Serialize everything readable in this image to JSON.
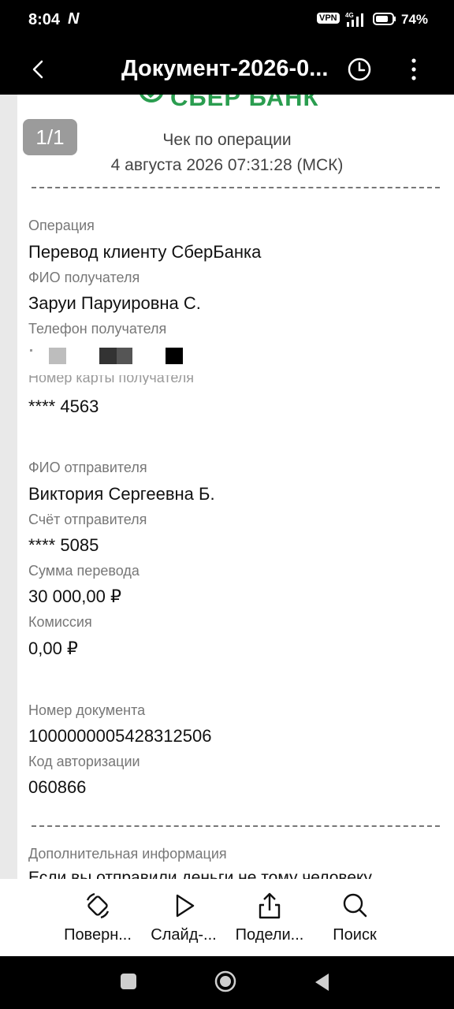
{
  "status_bar": {
    "time": "8:04",
    "vpn": "VPN",
    "network": "4G",
    "battery": "74%"
  },
  "app_bar": {
    "title": "Документ-2026-0..."
  },
  "document": {
    "logo_text": "СБЕР БАНК",
    "page_indicator": "1/1",
    "receipt_title": "Чек по операции",
    "receipt_datetime": "4 августа 2026 07:31:28 (МСК)",
    "partial_label": "Номер карты получателя",
    "fields": [
      {
        "label": "Операция",
        "value": "Перевод клиенту СберБанка"
      },
      {
        "label": "ФИО получателя",
        "value": "Заруи Паруировна С."
      },
      {
        "label": "Телефон получателя",
        "value": ""
      },
      {
        "label": "",
        "value": "**** 4563"
      },
      {
        "label": "ФИО отправителя",
        "value": "Виктория Сергеевна Б."
      },
      {
        "label": "Счёт отправителя",
        "value": "**** 5085"
      },
      {
        "label": "Сумма перевода",
        "value": "30 000,00 ₽"
      },
      {
        "label": "Комиссия",
        "value": "0,00 ₽"
      },
      {
        "label": "Номер документа",
        "value": "1000000005428312506"
      },
      {
        "label": "Код авторизации",
        "value": "060866"
      }
    ],
    "additional_label": "Дополнительная информация",
    "additional_text_partial": "Если вы отправили деньги не тому человеку"
  },
  "toolbar": {
    "rotate_label": "Поверн...",
    "slideshow_label": "Слайд-...",
    "share_label": "Подели...",
    "search_label": "Поиск"
  },
  "colors": {
    "status_bg": "#000000",
    "accent_green": "#2a9d4f",
    "badge_gray": "#9b9b9b"
  }
}
